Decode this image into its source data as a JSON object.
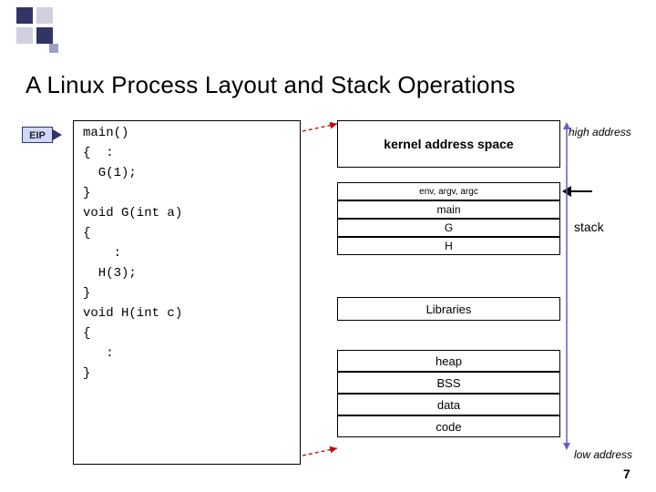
{
  "title": "A Linux Process Layout and Stack Operations",
  "eip_label": "EIP",
  "code": {
    "l1": "main()",
    "l2": "{  :",
    "l3": "  G(1);",
    "l4": "}",
    "l5": "void G(int a)",
    "l6": "{",
    "l7": "    :",
    "l8": "  H(3);",
    "l9": "}",
    "l10": "void H(int c)",
    "l11": "{",
    "l12": "   :",
    "l13": "}"
  },
  "mem": {
    "kernel": "kernel address space",
    "env": "env, argv, argc",
    "main": "main",
    "G": "G",
    "H": "H",
    "libraries": "Libraries",
    "heap": "heap",
    "bss": "BSS",
    "data": "data",
    "code": "code"
  },
  "labels": {
    "high": "high address",
    "low": "low address",
    "stack": "stack"
  },
  "page_number": "7"
}
